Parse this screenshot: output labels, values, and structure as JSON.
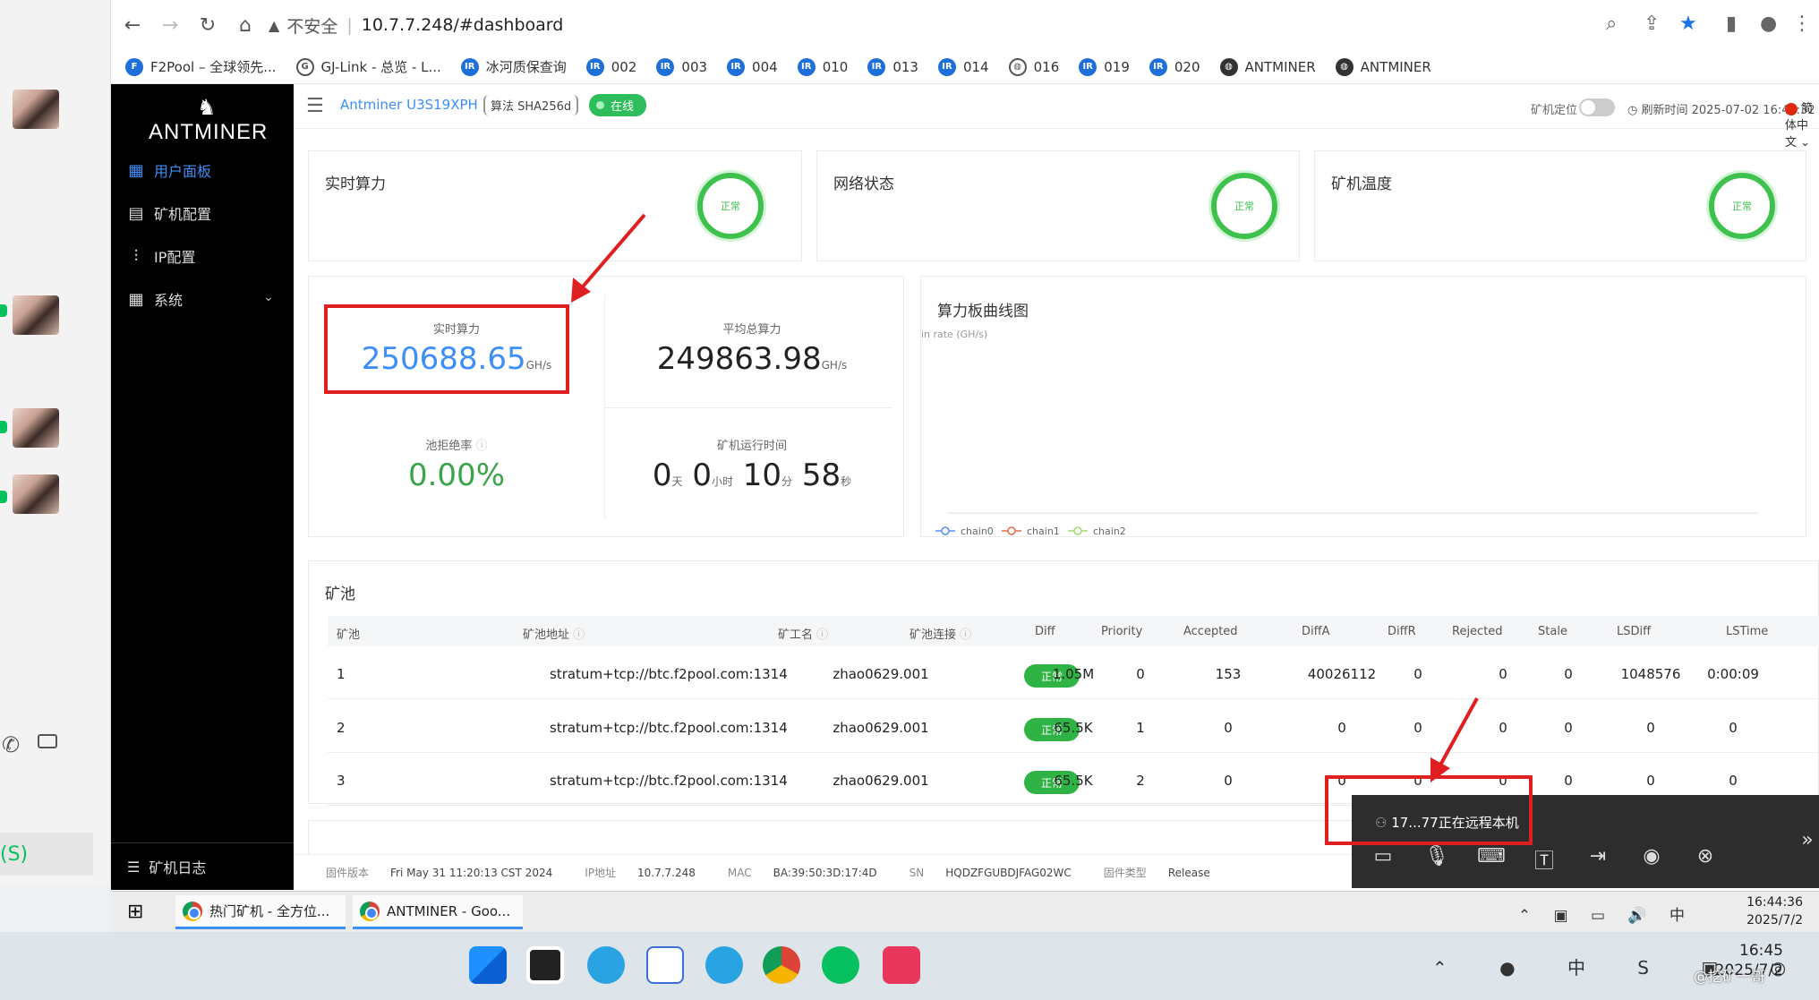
{
  "browser": {
    "insecure_label": "不安全",
    "url": "10.7.7.248/#dashboard",
    "bookmarks": [
      "F2Pool – 全球领先...",
      "GJ-Link - 总览 - L...",
      "冰河质保查询",
      "002",
      "003",
      "004",
      "010",
      "013",
      "014",
      "016",
      "019",
      "020",
      "ANTMINER",
      "ANTMINER"
    ]
  },
  "sidebar": {
    "logo": "ANTMINER",
    "items": [
      "用户面板",
      "矿机配置",
      "IP配置",
      "系统"
    ],
    "log": "矿机日志"
  },
  "header": {
    "model": "Antminer U3S19XPH",
    "algo": "算法 SHA256d",
    "status": "在线",
    "locate": "矿机定位",
    "refresh": "刷新时间 2025-07-02 16:44:32",
    "lang": "简体中文"
  },
  "status_cards": [
    {
      "title": "实时算力",
      "state": "正常"
    },
    {
      "title": "网络状态",
      "state": "正常"
    },
    {
      "title": "矿机温度",
      "state": "正常"
    }
  ],
  "stats": {
    "rt_label": "实时算力",
    "rt_value": "250688.65",
    "unit": "GH/s",
    "avg_label": "平均总算力",
    "avg_value": "249863.98",
    "reject_label": "池拒绝率",
    "reject_value": "0.00%",
    "uptime_label": "矿机运行时间",
    "uptime": {
      "d": "0",
      "d_u": "天",
      "h": "0",
      "h_u": "小时",
      "m": "10",
      "m_u": "分",
      "s": "58",
      "s_u": "秒"
    }
  },
  "chart_data": {
    "type": "line",
    "title": "算力板曲线图",
    "ylabel": "in rate (GH/s)",
    "series": [
      {
        "name": "chain0",
        "values": []
      },
      {
        "name": "chain1",
        "values": []
      },
      {
        "name": "chain2",
        "values": []
      }
    ],
    "colors": {
      "chain0": "#5b8ff9",
      "chain1": "#e8684a",
      "chain2": "#9fd96f"
    }
  },
  "pool": {
    "title": "矿池",
    "headers": [
      "矿池",
      "矿池地址",
      "矿工名",
      "矿池连接",
      "Diff",
      "Priority",
      "Accepted",
      "DiffA",
      "DiffR",
      "Rejected",
      "Stale",
      "LSDiff",
      "LSTime"
    ],
    "rows": [
      [
        "1",
        "stratum+tcp://btc.f2pool.com:1314",
        "zhao0629.001",
        "正常",
        "1.05M",
        "0",
        "153",
        "40026112",
        "0",
        "0",
        "0",
        "1048576",
        "0:00:09"
      ],
      [
        "2",
        "stratum+tcp://btc.f2pool.com:1314",
        "zhao0629.001",
        "正常",
        "65.5K",
        "1",
        "0",
        "0",
        "0",
        "0",
        "0",
        "0",
        "0"
      ],
      [
        "3",
        "stratum+tcp://btc.f2pool.com:1314",
        "zhao0629.001",
        "正常",
        "65.5K",
        "2",
        "0",
        "0",
        "0",
        "0",
        "0",
        "0",
        "0"
      ]
    ]
  },
  "footer": {
    "fw_k": "固件版本",
    "fw_v": "Fri May 31 11:20:13 CST 2024",
    "ip_k": "IP地址",
    "ip_v": "10.7.7.248",
    "mac_k": "MAC",
    "mac_v": "BA:39:50:3D:17:4D",
    "sn_k": "SN",
    "sn_v": "HQDZFGUBDJFAG02WC",
    "type_k": "固件类型",
    "type_v": "Release"
  },
  "remote": {
    "label": "17...77正在远程本机"
  },
  "taskbar": {
    "task1": "热门矿机 - 全方位...",
    "task2": "ANTMINER - Goo...",
    "time": "16:44:36",
    "date": "2025/7/2",
    "ime": "中"
  },
  "dock": {
    "time": "16:45",
    "date": "2025/7/2",
    "ime": "中",
    "watermark": "@挖矿一哥"
  },
  "left": {
    "s_label": "(S)"
  }
}
